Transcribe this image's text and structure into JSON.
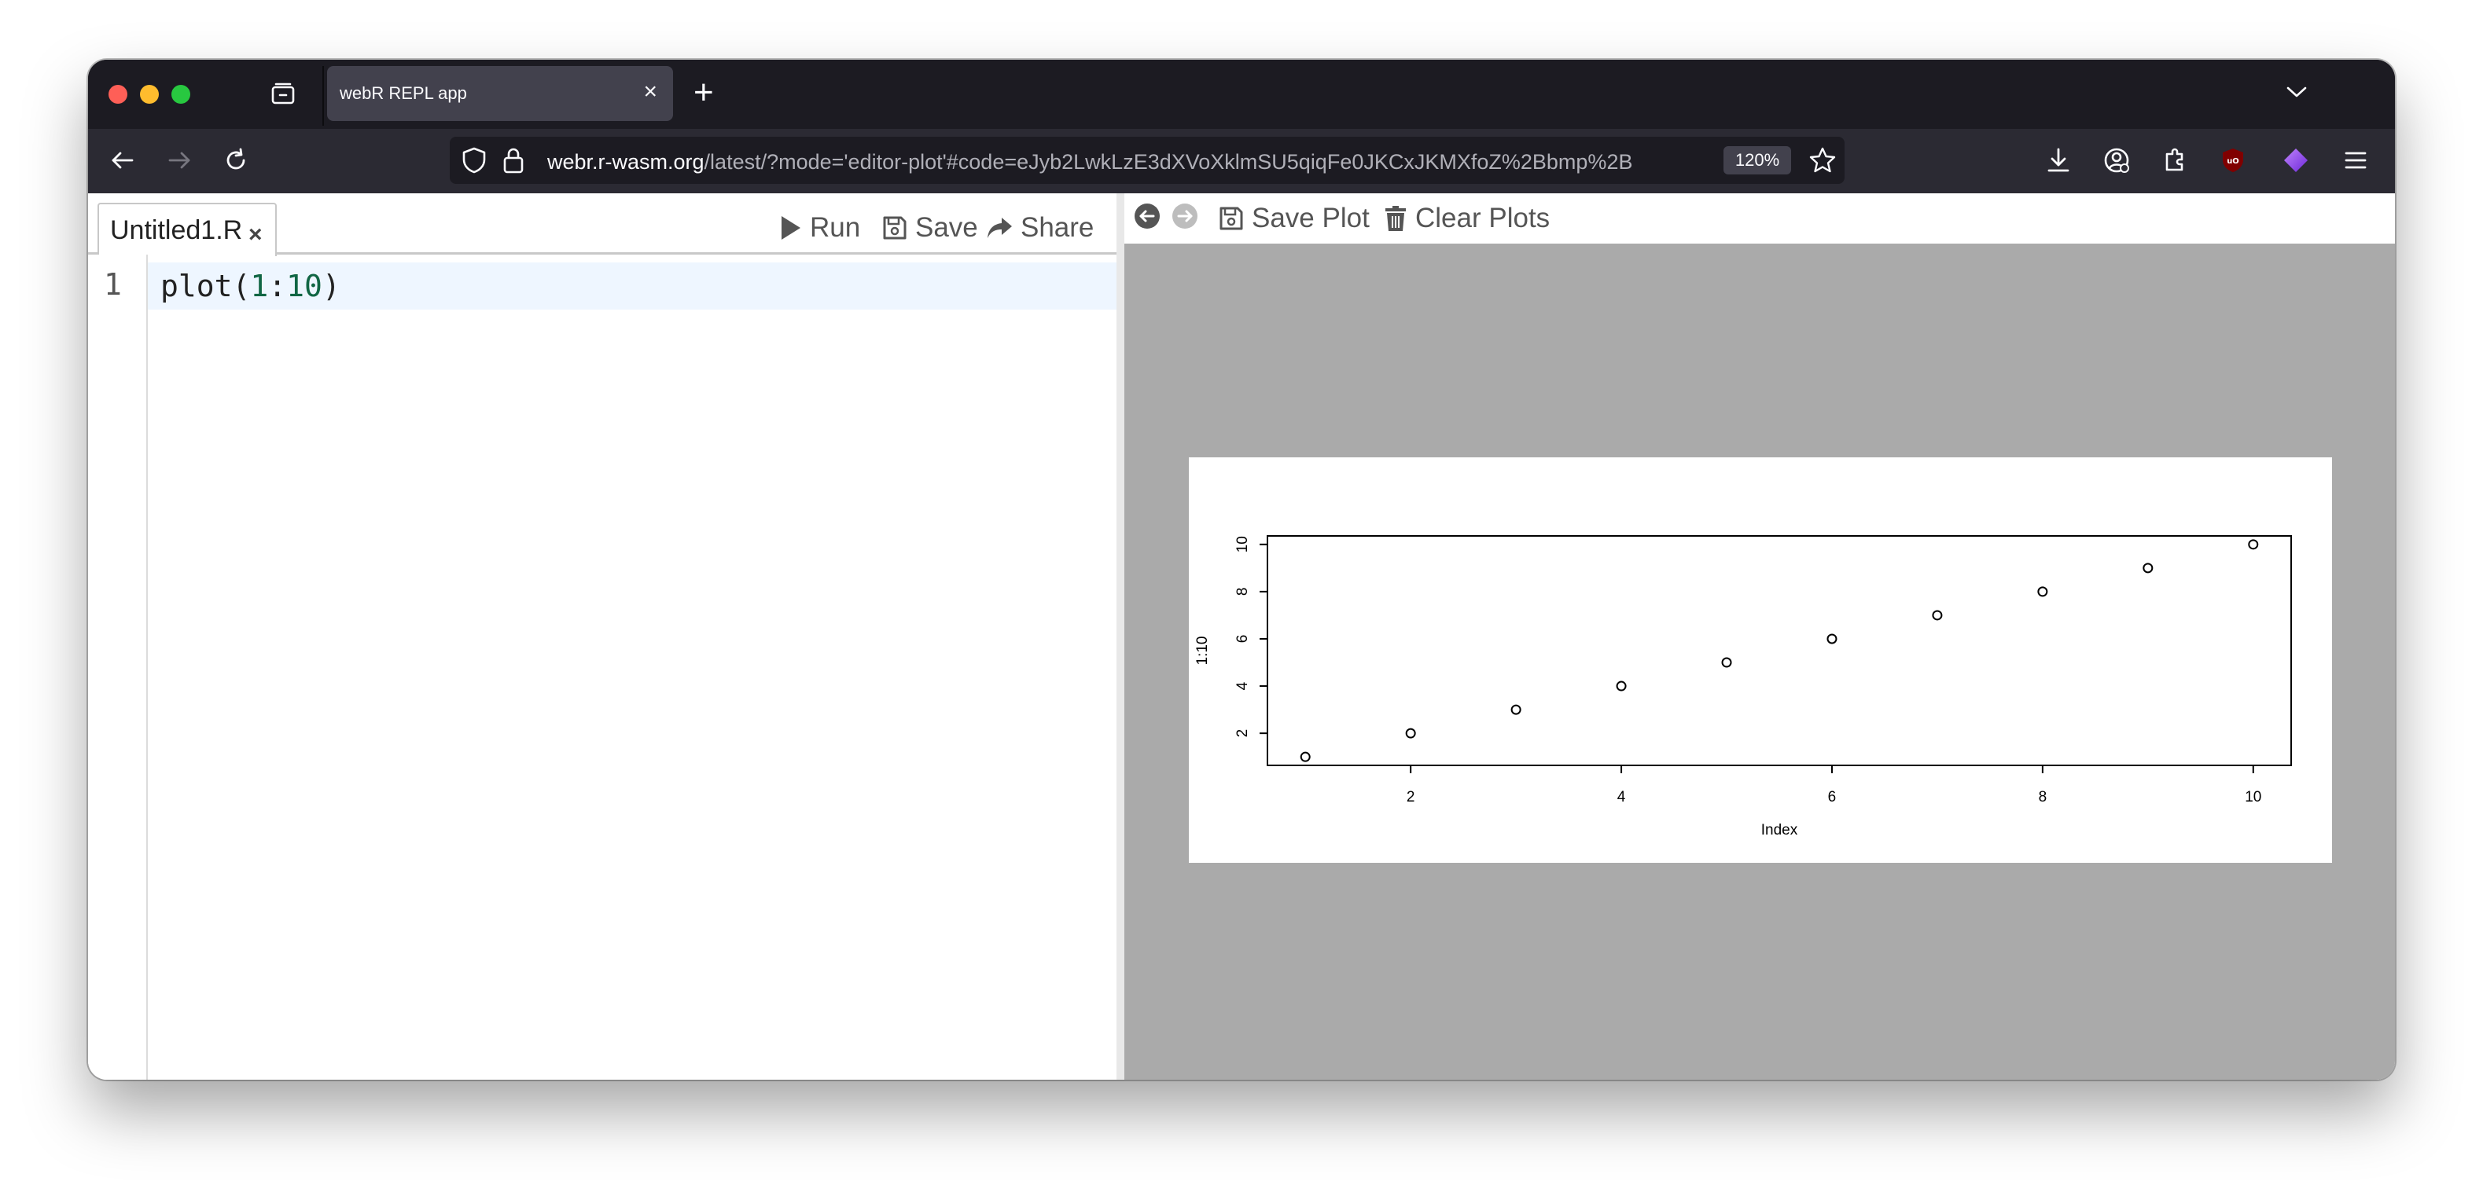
{
  "browser": {
    "tab_title": "webR REPL app",
    "tab_close": "×",
    "new_tab": "+",
    "url_host": "webr.r-wasm.org",
    "url_rest": "/latest/?mode='editor-plot'#code=eJyb2LwkLzE3dXVoXklmSU5qiqFe0JKCxJKMXfoZ%2Bbmp%2B",
    "zoom": "120%"
  },
  "editor": {
    "file_tab": "Untitled1.R",
    "file_tab_close": "×",
    "run_label": "Run",
    "save_label": "Save",
    "share_label": "Share",
    "line_number": "1",
    "code_prefix": "plot(",
    "code_arg_start": "1",
    "code_colon": ":",
    "code_arg_end": "10",
    "code_suffix": ")"
  },
  "plot_toolbar": {
    "save_plot_label": "Save Plot",
    "clear_plots_label": "Clear Plots"
  },
  "chart_data": {
    "type": "scatter",
    "title": "",
    "xlabel": "Index",
    "ylabel": "1:10",
    "x": [
      1,
      2,
      3,
      4,
      5,
      6,
      7,
      8,
      9,
      10
    ],
    "y": [
      1,
      2,
      3,
      4,
      5,
      6,
      7,
      8,
      9,
      10
    ],
    "xlim": [
      0.64,
      10.36
    ],
    "ylim": [
      0.64,
      10.36
    ],
    "x_ticks": [
      2,
      4,
      6,
      8,
      10
    ],
    "y_ticks": [
      2,
      4,
      6,
      8,
      10
    ],
    "marker": "open-circle",
    "grid": false
  }
}
